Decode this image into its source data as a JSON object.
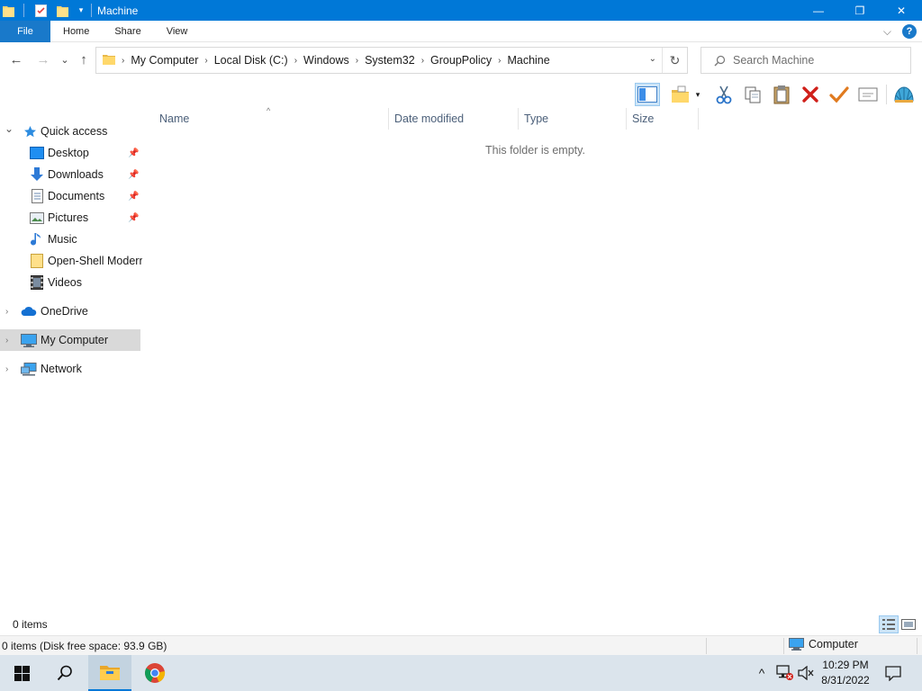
{
  "window": {
    "title": "Machine",
    "controls": {
      "minimize": "—",
      "maximize": "❐",
      "close": "✕"
    }
  },
  "ribbon": {
    "tabs": [
      {
        "label": "File"
      },
      {
        "label": "Home"
      },
      {
        "label": "Share"
      },
      {
        "label": "View"
      }
    ],
    "expand_glyph": "⌵",
    "help_glyph": "?"
  },
  "nav": {
    "back_glyph": "←",
    "forward_glyph": "→",
    "recent_glyph": "⌄",
    "up_glyph": "↑",
    "breadcrumbs": [
      {
        "label": "My Computer"
      },
      {
        "label": "Local Disk (C:)"
      },
      {
        "label": "Windows"
      },
      {
        "label": "System32"
      },
      {
        "label": "GroupPolicy"
      },
      {
        "label": "Machine"
      }
    ],
    "breadcrumb_separator": "›",
    "dropdown_glyph": "⌄",
    "refresh_glyph": "↻",
    "search_placeholder": "Search Machine"
  },
  "sidebar": {
    "quick_access": {
      "label": "Quick access",
      "chevron": "⌄"
    },
    "pin_glyph": "📌",
    "expand_glyph": "›",
    "items": [
      {
        "label": "Desktop",
        "icon": "desktop-icon",
        "pinned": true
      },
      {
        "label": "Downloads",
        "icon": "downloads-icon",
        "pinned": true
      },
      {
        "label": "Documents",
        "icon": "documents-icon",
        "pinned": true
      },
      {
        "label": "Pictures",
        "icon": "pictures-icon",
        "pinned": true
      },
      {
        "label": "Music",
        "icon": "music-icon",
        "pinned": false
      },
      {
        "label": "Open-Shell Modern",
        "icon": "folder-icon",
        "pinned": false
      },
      {
        "label": "Videos",
        "icon": "videos-icon",
        "pinned": false
      }
    ],
    "roots": [
      {
        "label": "OneDrive",
        "icon": "onedrive-icon"
      },
      {
        "label": "My Computer",
        "icon": "computer-icon",
        "selected": true
      },
      {
        "label": "Network",
        "icon": "network-icon"
      }
    ]
  },
  "content": {
    "columns": [
      {
        "label": "Name"
      },
      {
        "label": "Date modified"
      },
      {
        "label": "Type"
      },
      {
        "label": "Size"
      }
    ],
    "sort_glyph": "^",
    "empty_message": "This folder is empty."
  },
  "status": {
    "item_count": "0 items",
    "details": "0 items (Disk free space: 93.9 GB)",
    "location": "Computer"
  },
  "taskbar": {
    "clock_time": "10:29 PM",
    "clock_date": "8/31/2022",
    "tray_expand_glyph": "^"
  },
  "colors": {
    "accent": "#0078d7",
    "selection": "#d9d9d9",
    "taskbar": "#dbe4ec"
  }
}
